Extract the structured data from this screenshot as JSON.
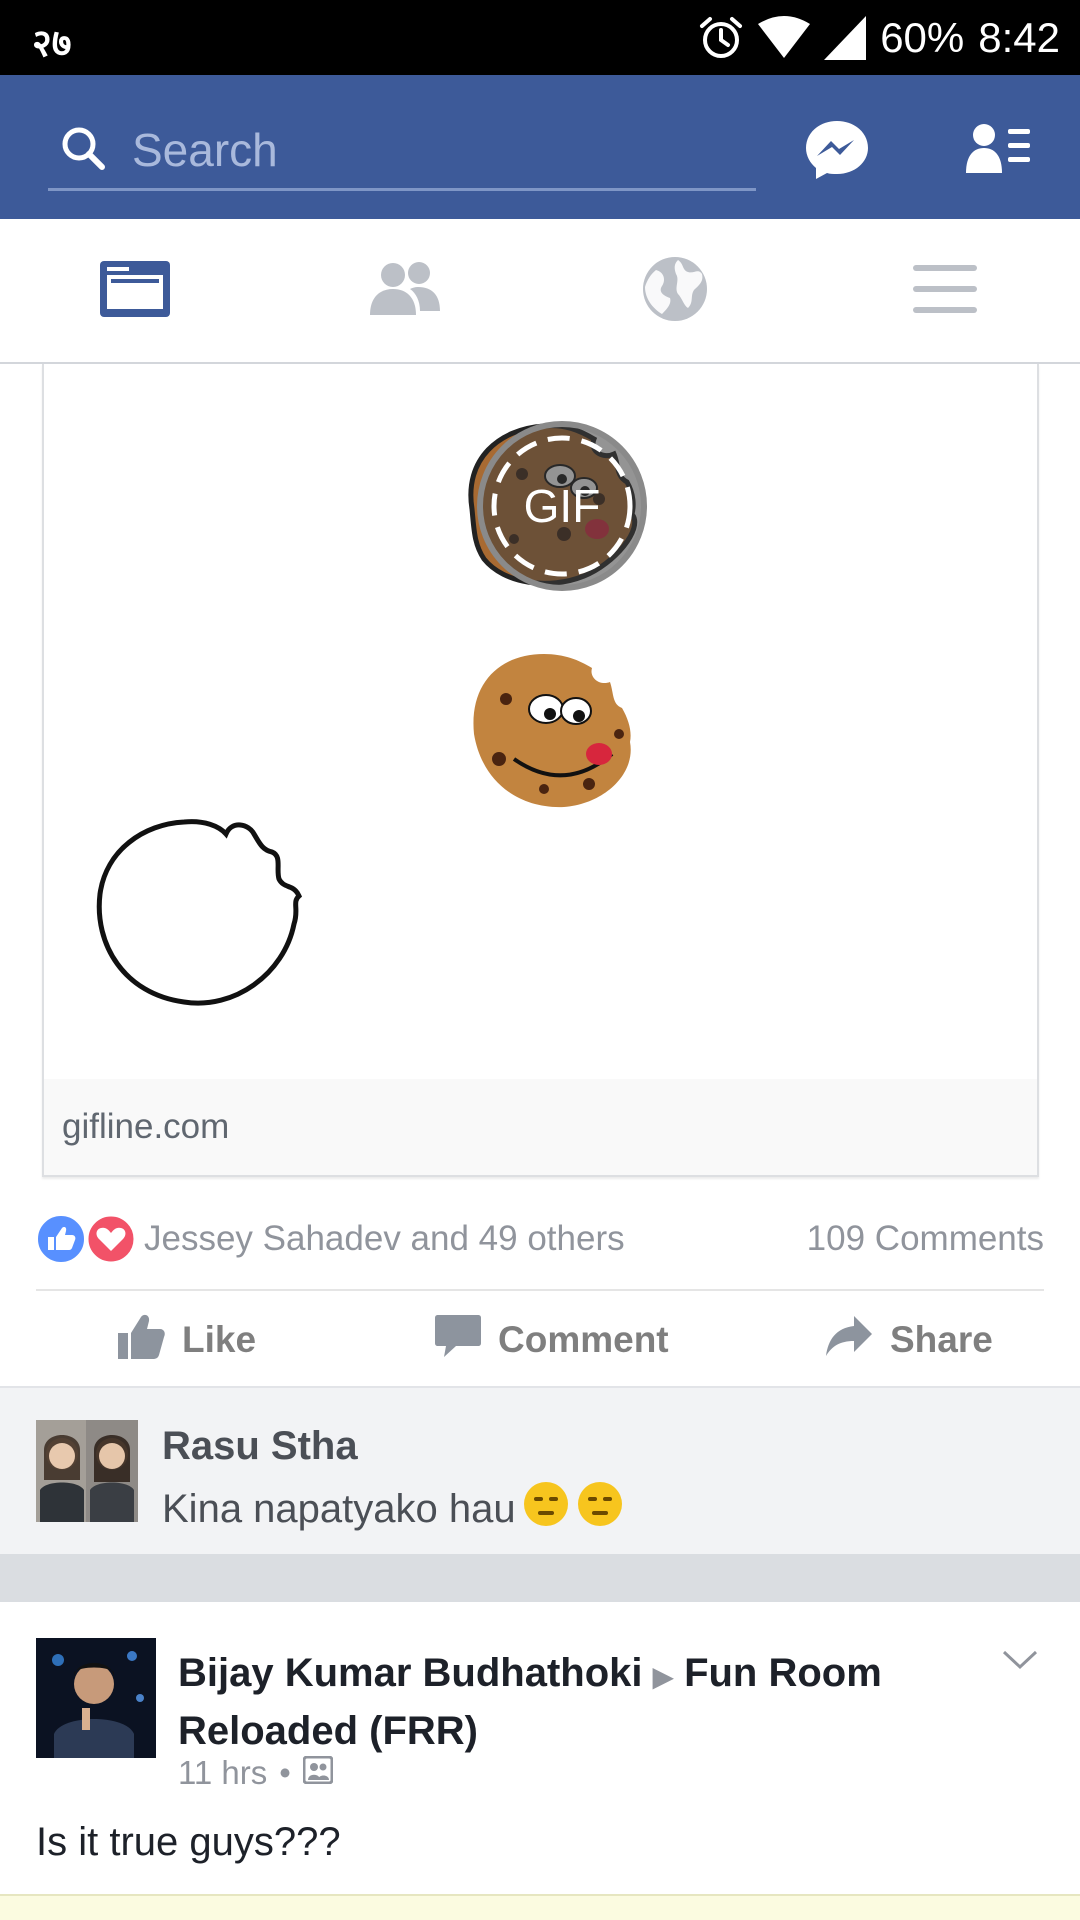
{
  "status_bar": {
    "carrier": "२७",
    "battery": "60%",
    "time": "8:42",
    "icons": [
      "alarm-icon",
      "wifi-icon",
      "cell-signal-icon"
    ]
  },
  "top_bar": {
    "search_placeholder": "Search",
    "icons": [
      "search-icon",
      "messenger-icon",
      "friend-requests-icon"
    ],
    "background": "#3d5a99"
  },
  "tabs": [
    {
      "name": "news-feed",
      "icon": "news-feed-icon",
      "active": true
    },
    {
      "name": "friends",
      "icon": "friends-icon",
      "active": false
    },
    {
      "name": "notifications",
      "icon": "globe-icon",
      "active": false
    },
    {
      "name": "menu",
      "icon": "menu-icon",
      "active": false
    }
  ],
  "link_card": {
    "overlay_label": "GIF",
    "domain": "gifline.com"
  },
  "reactions": {
    "names": "Jessey Sahadev and 49 others",
    "comments": "109 Comments",
    "icons": [
      "like-reaction-icon",
      "love-reaction-icon"
    ]
  },
  "actions": {
    "like": "Like",
    "comment": "Comment",
    "share": "Share"
  },
  "comment_preview": {
    "author": "Rasu Stha",
    "text": "Kina napatyako hau",
    "emoji": [
      "expressionless-face-icon",
      "expressionless-face-icon"
    ]
  },
  "next_post": {
    "author": "Bijay Kumar Budhathoki",
    "group": "Fun Room Reloaded (FRR)",
    "time": "11 hrs",
    "separator": "•",
    "body": "Is it true guys???"
  },
  "colors": {
    "facebook_blue": "#3d5a99",
    "like_blue": "#5890ff",
    "love_red": "#f25268",
    "muted_text": "#90949c"
  }
}
